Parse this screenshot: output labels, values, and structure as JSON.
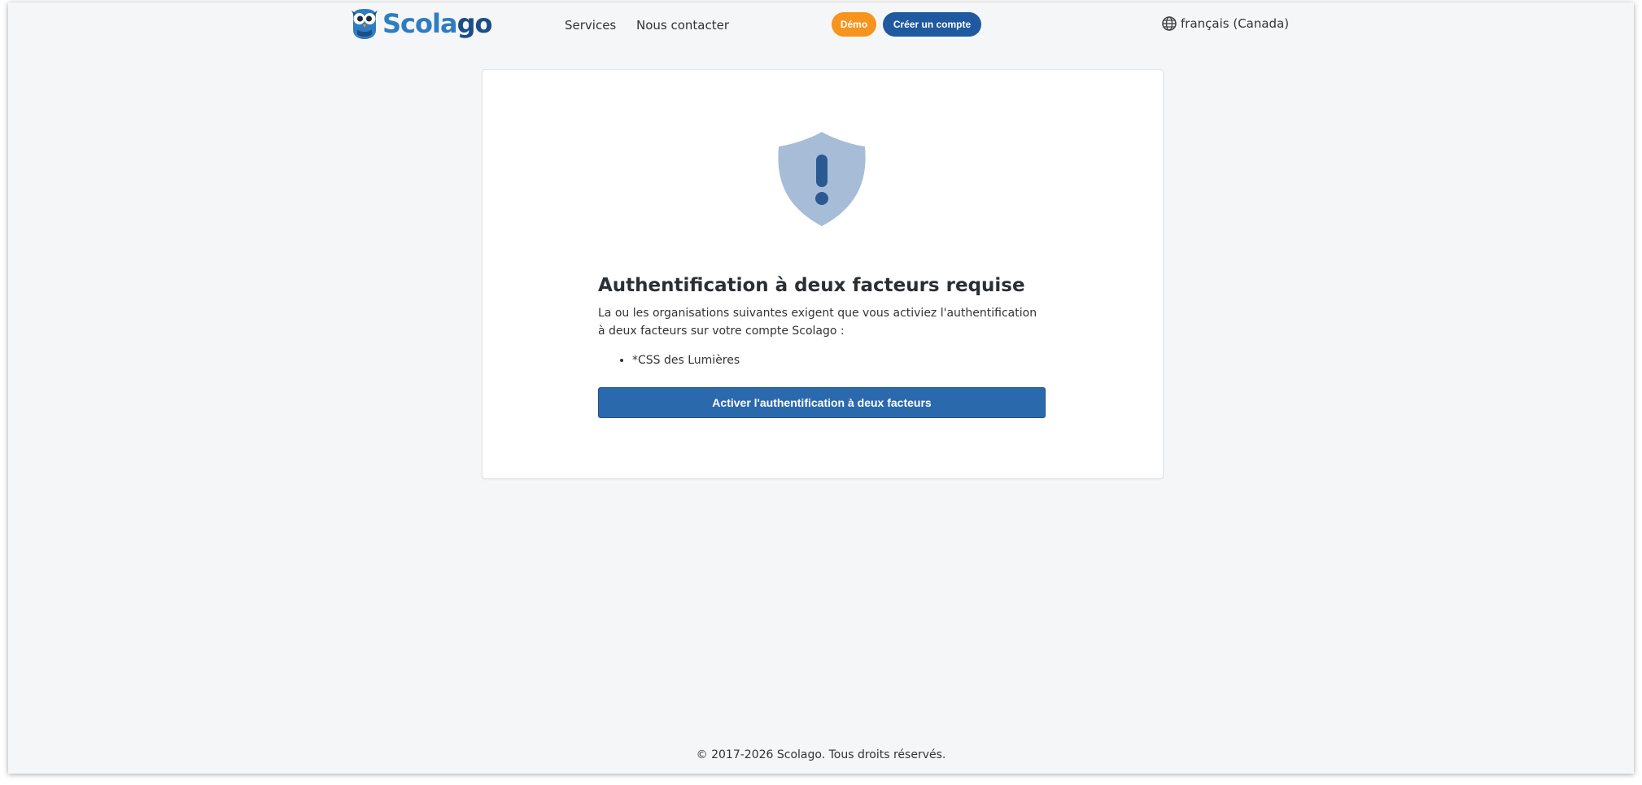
{
  "header": {
    "logo": {
      "text_part1": "Scola",
      "text_part2": "go",
      "icon": "owl-logo-icon"
    },
    "nav": [
      {
        "label": "Services"
      },
      {
        "label": "Nous contacter"
      }
    ],
    "demo_label": "Démo",
    "create_account_label": "Créer un compte",
    "language": {
      "icon": "globe-icon",
      "label": "français (Canada)"
    }
  },
  "card": {
    "icon": "shield-exclamation-icon",
    "title": "Authentification à deux facteurs requise",
    "description": "La ou les organisations suivantes exigent que vous activiez l'authentification à deux facteurs sur votre compte Scolago :",
    "organizations": [
      "*CSS des Lumières"
    ],
    "button_label": "Activer l'authentification à deux facteurs"
  },
  "footer": {
    "copyright": "© 2017-2026 Scolago. Tous droits réservés."
  },
  "colors": {
    "accent_blue": "#2b69ad",
    "demo_orange": "#f7941d",
    "shield_fill": "#a7bcd6",
    "shield_mark": "#2b5a93"
  }
}
